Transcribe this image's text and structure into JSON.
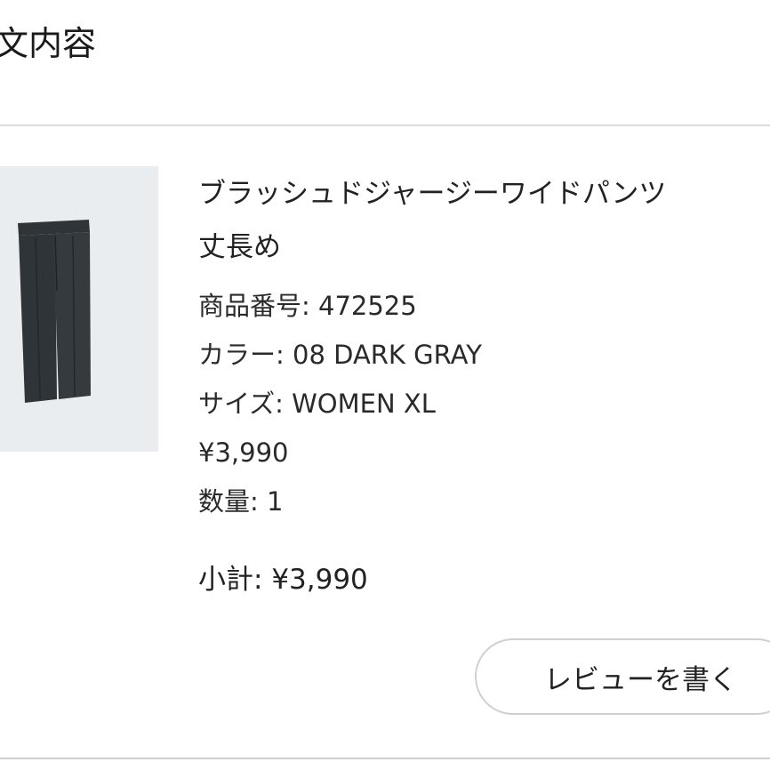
{
  "section": {
    "title": "文内容"
  },
  "product": {
    "image_icon": "pants-product-image",
    "name_line1": "ブラッシュドジャージーワイドパンツ",
    "name_line2": "丈長め",
    "item_number_label": "商品番号:",
    "item_number": "472525",
    "color_label": "カラー:",
    "color": "08 DARK GRAY",
    "size_label": "サイズ:",
    "size": "WOMEN XL",
    "price": "¥3,990",
    "quantity_label": "数量:",
    "quantity": "1",
    "subtotal_label": "小計:",
    "subtotal": "¥3,990"
  },
  "actions": {
    "review_label": "レビューを書く"
  },
  "colors": {
    "thumb_bg": "#e9edef",
    "pants": "#2f3438",
    "divider": "#dcdcdc"
  }
}
